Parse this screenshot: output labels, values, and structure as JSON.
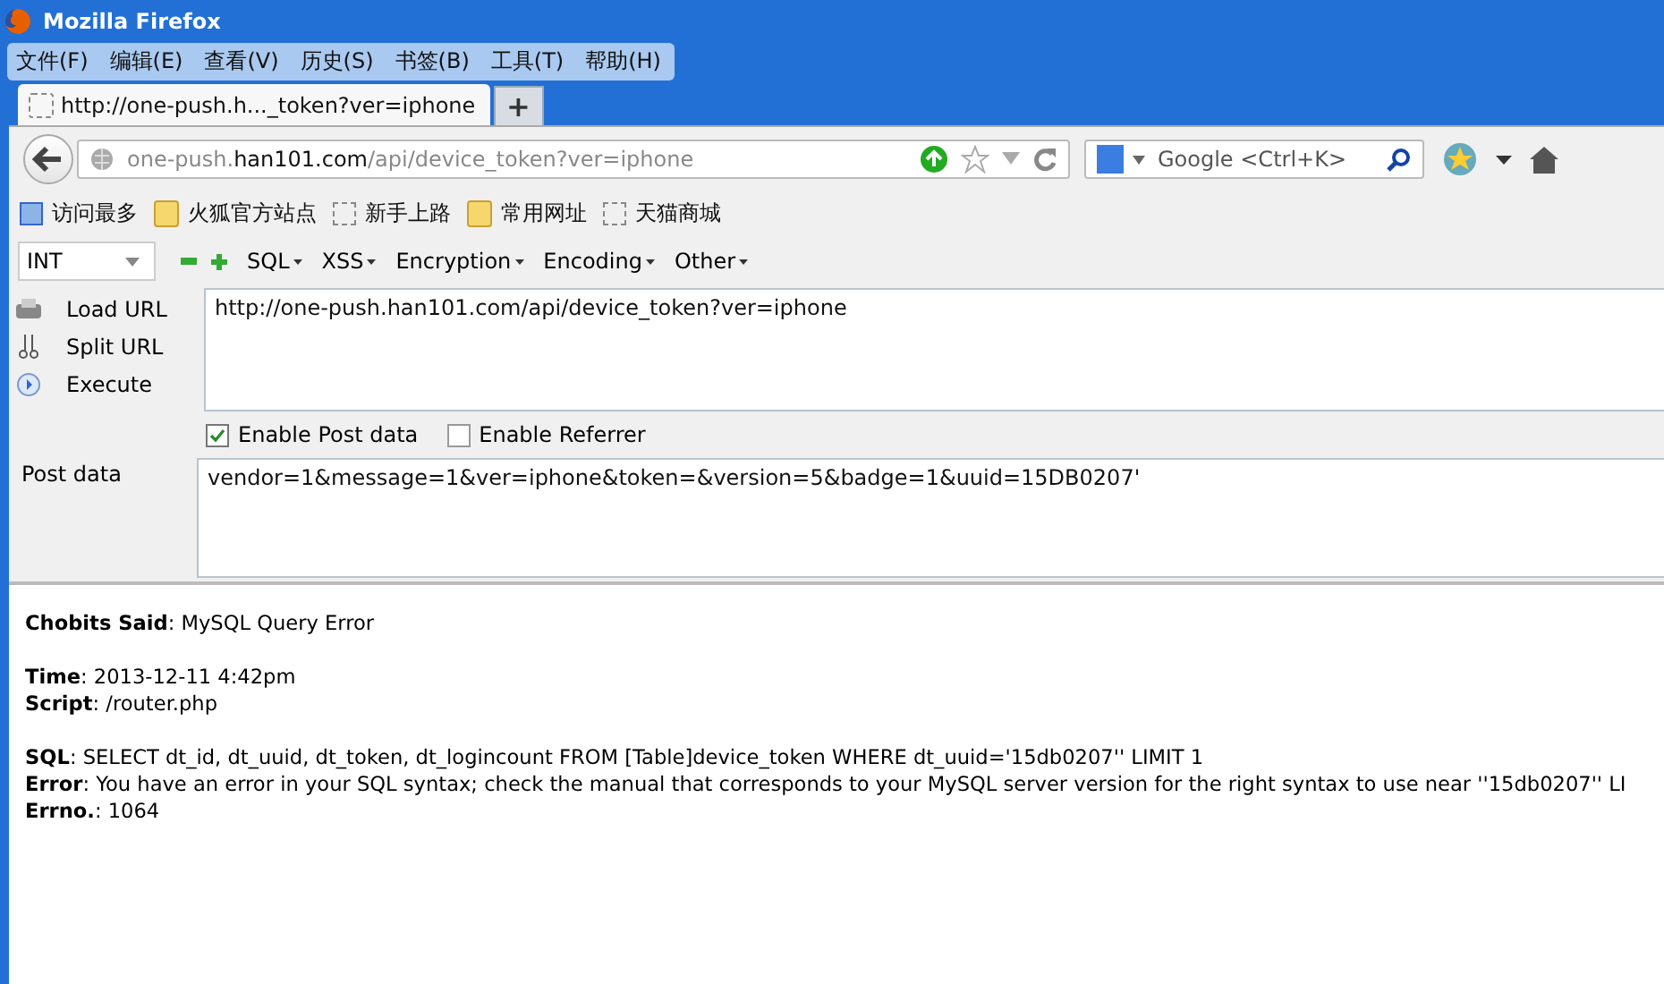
{
  "window": {
    "title": "Mozilla Firefox"
  },
  "menu": [
    "文件(F)",
    "编辑(E)",
    "查看(V)",
    "历史(S)",
    "书签(B)",
    "工具(T)",
    "帮助(H)"
  ],
  "tabs": [
    {
      "label": "http://one-push.h..._token?ver=iphone",
      "selected": true
    }
  ],
  "new_tab": "+",
  "address": {
    "prefix": "one-push.",
    "domain": "han101.com",
    "path": "/api/device_token?ver=iphone"
  },
  "search": {
    "placeholder": "Google <Ctrl+K>"
  },
  "bookmarks": [
    {
      "label": "访问最多",
      "kind": "smart"
    },
    {
      "label": "火狐官方站点",
      "kind": "folder"
    },
    {
      "label": "新手上路",
      "kind": "page"
    },
    {
      "label": "常用网址",
      "kind": "folder"
    },
    {
      "label": "天猫商城",
      "kind": "page"
    }
  ],
  "hackbar": {
    "select": "INT",
    "menus": [
      "SQL",
      "XSS",
      "Encryption",
      "Encoding",
      "Other"
    ],
    "actions": [
      {
        "label": "Load URL",
        "kind": "load"
      },
      {
        "label": "Split URL",
        "kind": "split"
      },
      {
        "label": "Execute",
        "kind": "execute"
      }
    ],
    "url": "http://one-push.han101.com/api/device_token?ver=iphone",
    "options": [
      {
        "label": "Enable Post data",
        "checked": true
      },
      {
        "label": "Enable Referrer",
        "checked": false
      }
    ],
    "post_label": "Post data",
    "post_data": "vendor=1&message=1&ver=iphone&token=&version=5&badge=1&uuid=15DB0207'"
  },
  "error_page": [
    [
      "**Chobits Said**: MySQL Query Error"
    ],
    [
      "**Time**: 2013-12-11 4:42pm",
      "**Script**: /router.php"
    ],
    [
      "**SQL**: SELECT dt_id, dt_uuid, dt_token, dt_logincount FROM [Table]device_token WHERE dt_uuid='15db0207'' LIMIT 1",
      "**Error**: You have an error in your SQL syntax; check the manual that corresponds to your MySQL server version for the right syntax to use near ''15db0207'' LI",
      "**Errno.**: 1064"
    ]
  ]
}
